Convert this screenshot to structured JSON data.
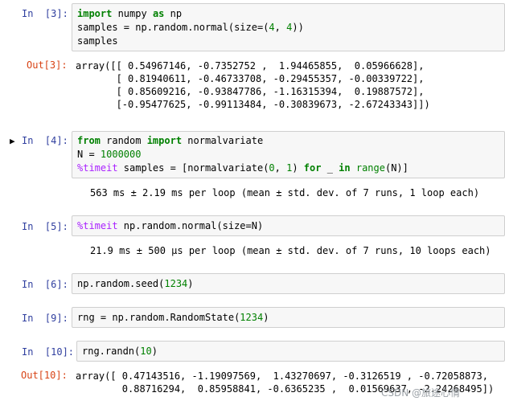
{
  "cells": [
    {
      "in_prompt": "In  [3]:",
      "code": [
        [
          {
            "t": "import",
            "c": "kw"
          },
          {
            "t": " numpy "
          },
          {
            "t": "as",
            "c": "kw"
          },
          {
            "t": " np"
          }
        ],
        [
          {
            "t": "samples = np.random.normal(size=("
          },
          {
            "t": "4",
            "c": "num"
          },
          {
            "t": ", "
          },
          {
            "t": "4",
            "c": "num"
          },
          {
            "t": "))"
          }
        ],
        [
          {
            "t": "samples"
          }
        ]
      ],
      "out_prompt": "Out[3]:",
      "output": [
        "array([[ 0.54967146, -0.7352752 ,  1.94465855,  0.05966628],",
        "       [ 0.81940611, -0.46733708, -0.29455357, -0.00339722],",
        "       [ 0.85609216, -0.93847786, -1.16315394,  0.19887572],",
        "       [-0.95477625, -0.99113484, -0.30839673, -2.67243343]])"
      ]
    },
    {
      "in_prompt": "In  [4]:",
      "selected_marker": "▶",
      "code": [
        [
          {
            "t": "from",
            "c": "kw"
          },
          {
            "t": " random "
          },
          {
            "t": "import",
            "c": "kw"
          },
          {
            "t": " normalvariate"
          }
        ],
        [
          {
            "t": "N = "
          },
          {
            "t": "1000000",
            "c": "num"
          }
        ],
        [
          {
            "t": "%timeit",
            "c": "magic"
          },
          {
            "t": " samples = [normalvariate("
          },
          {
            "t": "0",
            "c": "num"
          },
          {
            "t": ", "
          },
          {
            "t": "1",
            "c": "num"
          },
          {
            "t": ") "
          },
          {
            "t": "for",
            "c": "kw"
          },
          {
            "t": " _ "
          },
          {
            "t": "in",
            "c": "kw"
          },
          {
            "t": " "
          },
          {
            "t": "range",
            "c": "bi"
          },
          {
            "t": "(N)]"
          }
        ]
      ],
      "output": [
        "563 ms ± 2.19 ms per loop (mean ± std. dev. of 7 runs, 1 loop each)"
      ]
    },
    {
      "in_prompt": "In  [5]:",
      "code": [
        [
          {
            "t": "%timeit",
            "c": "magic"
          },
          {
            "t": " np.random.normal(size=N)"
          }
        ]
      ],
      "output": [
        "21.9 ms ± 500 µs per loop (mean ± std. dev. of 7 runs, 10 loops each)"
      ]
    },
    {
      "in_prompt": "In  [6]:",
      "code": [
        [
          {
            "t": "np.random.seed("
          },
          {
            "t": "1234",
            "c": "num"
          },
          {
            "t": ")"
          }
        ]
      ]
    },
    {
      "in_prompt": "In  [9]:",
      "code": [
        [
          {
            "t": "rng = np.random.RandomState("
          },
          {
            "t": "1234",
            "c": "num"
          },
          {
            "t": ")"
          }
        ]
      ]
    },
    {
      "in_prompt": "In  [10]:",
      "code": [
        [
          {
            "t": "rng.randn("
          },
          {
            "t": "10",
            "c": "num"
          },
          {
            "t": ")"
          }
        ]
      ],
      "out_prompt": "Out[10]:",
      "output": [
        "array([ 0.47143516, -1.19097569,  1.43270697, -0.3126519 , -0.72058873,",
        "        0.88716294,  0.85958841, -0.6365235 ,  0.01569637, -2.24268495])"
      ]
    }
  ],
  "watermark": "CSDN @旅途心情"
}
